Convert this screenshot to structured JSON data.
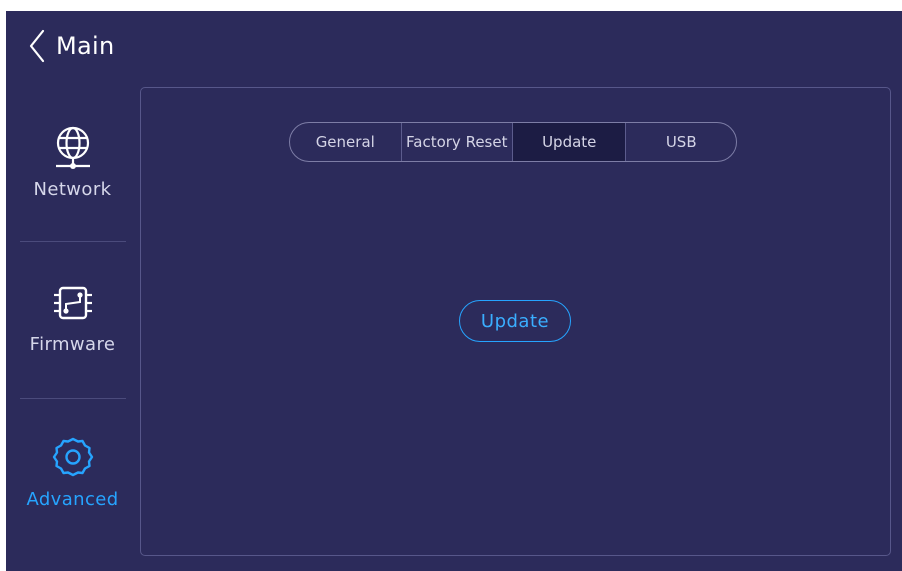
{
  "header": {
    "title": "Main",
    "back_icon": "chevron-left-icon"
  },
  "sidebar": {
    "items": [
      {
        "label": "Network",
        "icon": "globe-network-icon",
        "active": false
      },
      {
        "label": "Firmware",
        "icon": "circuit-board-icon",
        "active": false
      },
      {
        "label": "Advanced",
        "icon": "gear-icon",
        "active": true
      }
    ]
  },
  "tabs": [
    {
      "label": "General",
      "active": false
    },
    {
      "label": "Factory Reset",
      "active": false
    },
    {
      "label": "Update",
      "active": true
    },
    {
      "label": "USB",
      "active": false
    }
  ],
  "main": {
    "update_button": "Update"
  },
  "colors": {
    "background": "#2c2b5b",
    "accent": "#26a4ff",
    "text": "#d6d7ea",
    "active_tab": "#1c1c44"
  }
}
